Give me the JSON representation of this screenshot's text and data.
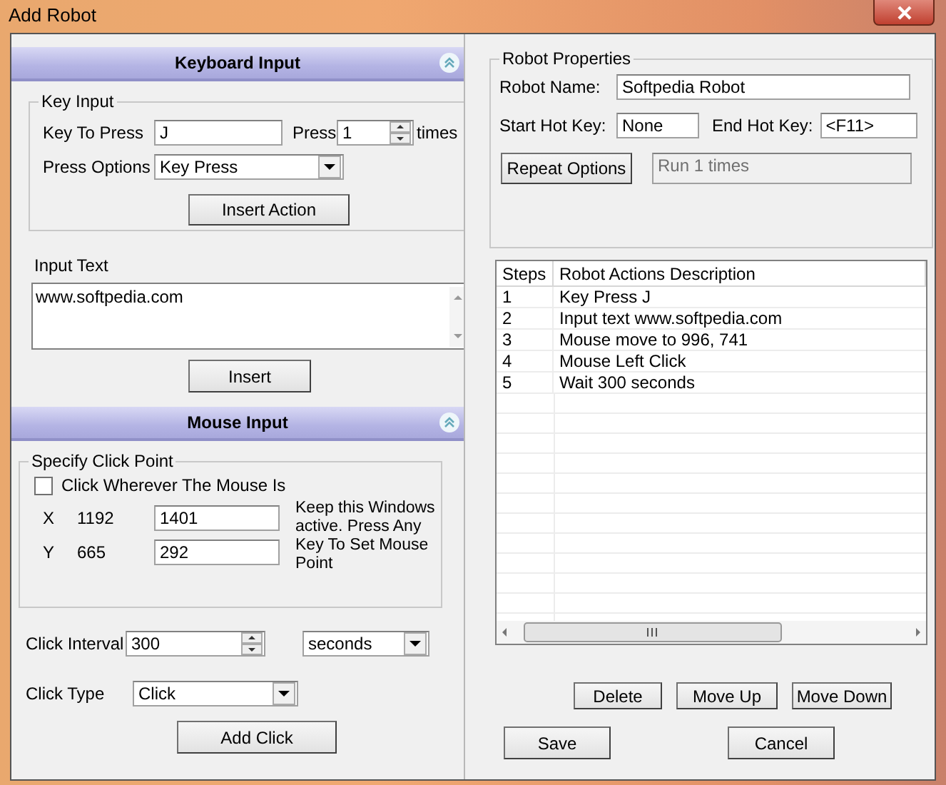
{
  "window": {
    "title": "Add Robot"
  },
  "keyboard_input": {
    "title": "Keyboard Input",
    "expanded": true,
    "group_label": "Key Input",
    "key_to_press": {
      "label": "Key To Press",
      "value": "J"
    },
    "press": {
      "label": "Press",
      "value": "1",
      "suffix": "times"
    },
    "press_options": {
      "label": "Press Options",
      "value": "Key Press"
    },
    "insert_action_button": "Insert Action",
    "input_text": {
      "label": "Input Text",
      "value": "www.softpedia.com"
    },
    "insert_button": "Insert"
  },
  "mouse_input": {
    "title": "Mouse Input",
    "expanded": true,
    "group_label": "Specify Click Point",
    "click_anywhere": {
      "label": "Click Wherever The Mouse Is",
      "checked": false
    },
    "coordinates": [
      {
        "axis": "X",
        "reading": "1192",
        "value": "1401"
      },
      {
        "axis": "Y",
        "reading": "665",
        "value": "292"
      }
    ],
    "hint": "Keep this Windows active. Press Any Key To Set Mouse Point",
    "click_interval": {
      "label": "Click Interval",
      "value": "300",
      "unit": "seconds"
    },
    "click_type": {
      "label": "Click Type",
      "value": "Click"
    },
    "add_click_button": "Add Click"
  },
  "robot_properties": {
    "group_label": "Robot Properties",
    "robot_name": {
      "label": "Robot Name:",
      "value": "Softpedia Robot"
    },
    "start_hot_key": {
      "label": "Start Hot Key:",
      "value": "None"
    },
    "end_hot_key": {
      "label": "End Hot Key:",
      "value": "<F11>"
    },
    "repeat_button": "Repeat Options",
    "repeat_summary": "Run 1 times"
  },
  "table": {
    "columns": [
      "Steps",
      "Robot Actions Description"
    ],
    "rows": [
      [
        "1",
        "Key Press J"
      ],
      [
        "2",
        "Input text www.softpedia.com"
      ],
      [
        "3",
        "Mouse move to 996, 741"
      ],
      [
        "4",
        "Mouse Left Click"
      ],
      [
        "5",
        "Wait 300 seconds"
      ]
    ]
  },
  "list_buttons": [
    "Delete",
    "Move Up",
    "Move Down"
  ],
  "dialog_buttons": [
    "Save",
    "Cancel"
  ]
}
